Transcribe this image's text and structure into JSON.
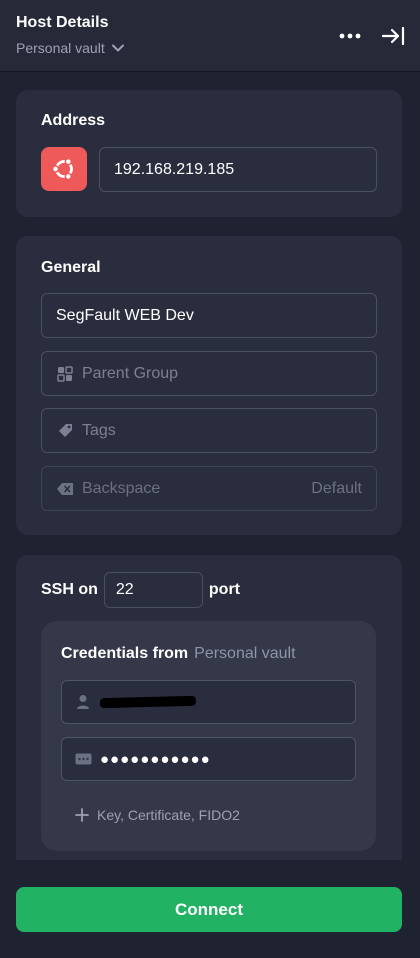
{
  "header": {
    "title": "Host Details",
    "vault_label": "Personal vault",
    "icons": {
      "vault_chevron": "chevron-down-icon",
      "more": "more-horizontal-icon",
      "collapse": "collapse-panel-icon"
    }
  },
  "address": {
    "title": "Address",
    "os_icon": "ubuntu-icon",
    "os_color": "#ee5a5a",
    "value": "192.168.219.185"
  },
  "general": {
    "title": "General",
    "label_value": "SegFault WEB Dev",
    "parent_group_placeholder": "Parent Group",
    "tags_placeholder": "Tags",
    "backspace_placeholder": "Backspace",
    "backspace_value": "Default",
    "icons": {
      "parent_group": "group-icon",
      "tags": "tag-icon",
      "backspace": "backspace-icon"
    }
  },
  "ssh": {
    "prefix": "SSH on",
    "port": "22",
    "suffix": "port",
    "credentials_title": "Credentials from",
    "credentials_vault": "Personal vault",
    "password_mask": "●●●●●●●●●●●",
    "add_credentials_label": "Key, Certificate, FIDO2",
    "icons": {
      "username": "user-icon",
      "password": "password-icon",
      "add": "plus-icon"
    }
  },
  "actions": {
    "connect_label": "Connect",
    "connect_color": "#21b263"
  }
}
